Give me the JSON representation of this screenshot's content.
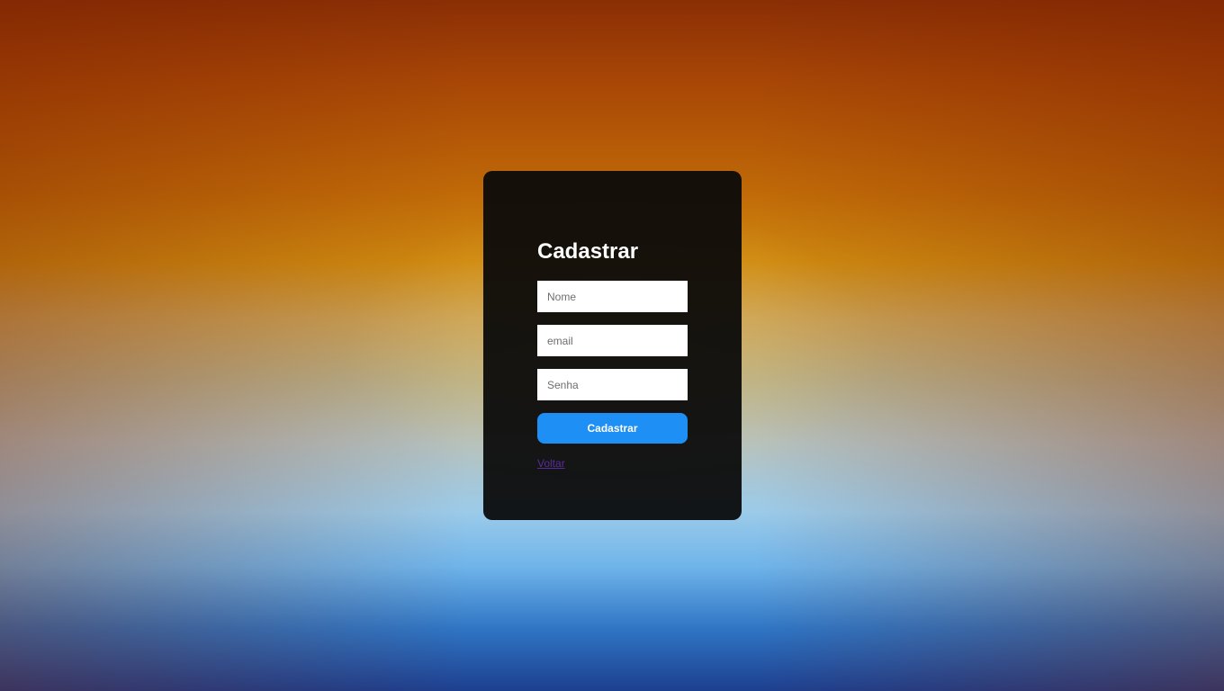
{
  "form": {
    "title": "Cadastrar",
    "name_placeholder": "Nome",
    "email_placeholder": "email",
    "password_placeholder": "Senha",
    "submit_label": "Cadastrar",
    "back_link": "Voltar"
  },
  "colors": {
    "button": "#1e8ff5",
    "link": "#5b2b9c",
    "card": "#0a0a0a"
  }
}
